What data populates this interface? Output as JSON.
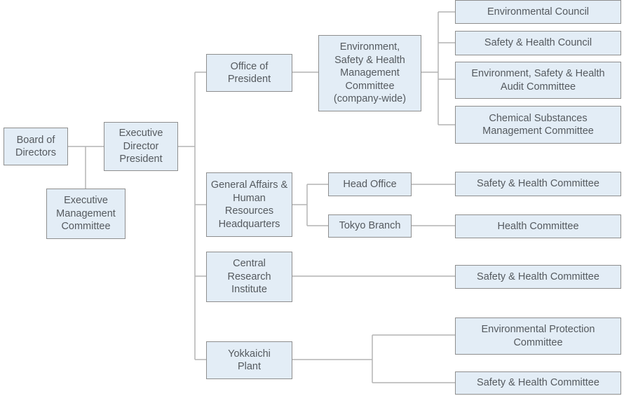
{
  "chart_title": "",
  "nodes": {
    "board_of_directors": "Board of Directors",
    "executive_management_committee": "Executive Management Committee",
    "executive_director_president": "Executive Director President",
    "office_of_president": "Office of President",
    "esh_management_committee": "Environment, Safety & Health Management Committee (company-wide)",
    "environmental_council": "Environmental Council",
    "safety_health_council": "Safety & Health Council",
    "esh_audit_committee": "Environment, Safety & Health Audit Committee",
    "chemical_substances_committee": "Chemical Substances Management Committee",
    "general_affairs_hq": "General Affairs & Human Resources Headquarters",
    "head_office": "Head Office",
    "tokyo_branch": "Tokyo Branch",
    "head_office_safety_health_committee": "Safety & Health Committee",
    "tokyo_branch_health_committee": "Health Committee",
    "central_research_institute": "Central Research Institute",
    "cri_safety_health_committee": "Safety & Health Committee",
    "yokkaichi_plant": "Yokkaichi Plant",
    "environmental_protection_committee": "Environmental Protection Committee",
    "yokkaichi_safety_health_committee": "Safety & Health Committee"
  },
  "colors": {
    "box_fill": "#e3edf6",
    "box_border": "#8e8e8e",
    "connector": "#b4b4b4",
    "text": "#555a5f"
  }
}
